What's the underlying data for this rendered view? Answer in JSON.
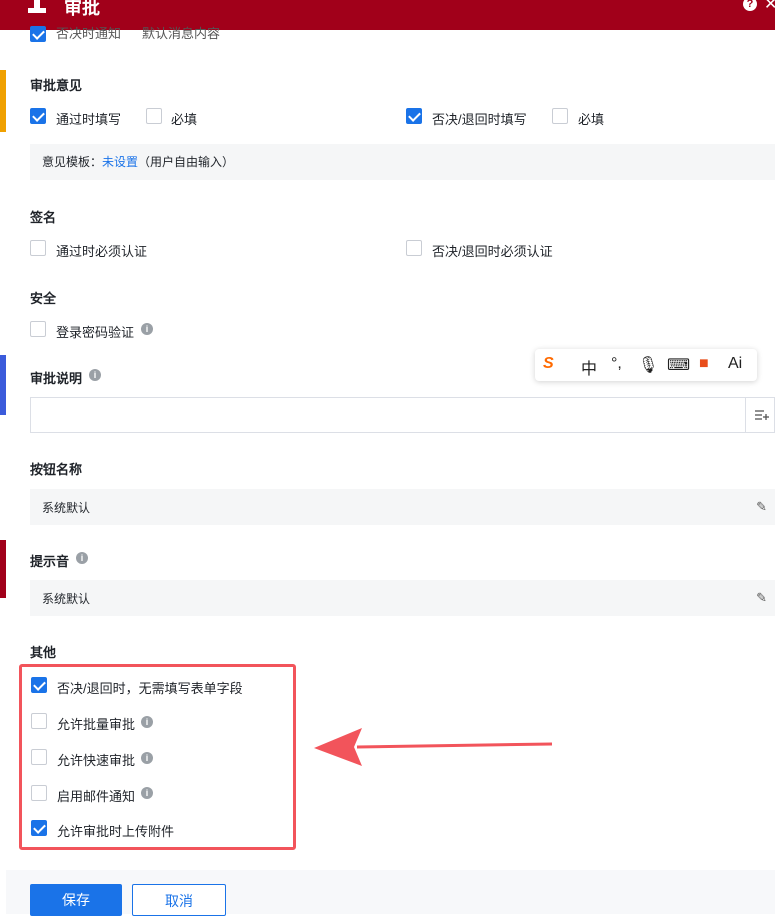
{
  "header": {
    "title": "审批"
  },
  "top_row": {
    "left_label": "否决时通知",
    "right_value": "默认消息内容"
  },
  "approval_opinion": {
    "title": "审批意见",
    "pass_fill_label": "通过时填写",
    "pass_required_label": "必填",
    "reject_fill_label": "否决/退回时填写",
    "reject_required_label": "必填",
    "template_prefix": "意见模板：",
    "template_link": "未设置",
    "template_suffix": "（用户自由输入）"
  },
  "signature": {
    "title": "签名",
    "pass_auth_label": "通过时必须认证",
    "reject_auth_label": "否决/退回时必须认证"
  },
  "security": {
    "title": "安全",
    "password_label": "登录密码验证"
  },
  "approval_note": {
    "title": "审批说明"
  },
  "button_name": {
    "title": "按钮名称",
    "value": "系统默认"
  },
  "sound": {
    "title": "提示音",
    "value": "系统默认"
  },
  "other": {
    "title": "其他",
    "items": [
      {
        "label": "否决/退回时，无需填写表单字段",
        "checked": true
      },
      {
        "label": "允许批量审批",
        "checked": false
      },
      {
        "label": "允许快速审批",
        "checked": false
      },
      {
        "label": "启用邮件通知",
        "checked": false
      },
      {
        "label": "允许审批时上传附件",
        "checked": true
      }
    ]
  },
  "footer": {
    "save_label": "保存",
    "cancel_label": "取消"
  },
  "ime_toolbar": {
    "chinese_label": "中",
    "ai_label": "Ai"
  },
  "colors": {
    "header": "#a1001a",
    "accent": "#1a73e8",
    "highlight": "#f2545b"
  }
}
